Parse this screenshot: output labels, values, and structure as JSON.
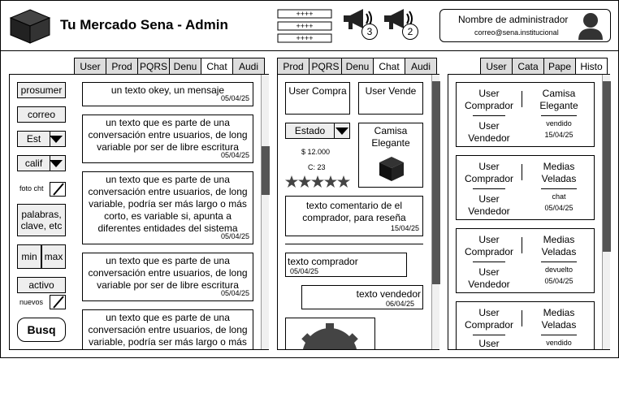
{
  "header": {
    "title": "Tu Mercado Sena - Admin",
    "notifications": [
      {
        "count": "3"
      },
      {
        "count": "2"
      }
    ],
    "admin_name": "Nombre de administrador",
    "admin_email": "correo@sena.institucional"
  },
  "left_panel": {
    "tabs": [
      "User",
      "Prod",
      "PQRS",
      "Denu",
      "Chat",
      "Audi"
    ],
    "active_tab": "Chat",
    "filters": {
      "prosumer": "prosumer",
      "correo": "correo",
      "estado": "Est",
      "calif": "calif",
      "foto_label": "foto cht",
      "keywords": "palabras, clave, etc",
      "min": "min",
      "max": "max",
      "activo": "activo",
      "nuevos_label": "nuevos",
      "search": "Busq"
    },
    "messages": [
      {
        "text": "un texto okey, un mensaje",
        "date": "05/04/25"
      },
      {
        "text": "un texto que es parte de una conversación entre usuarios, de long variable por ser de libre escritura",
        "date": "05/04/25"
      },
      {
        "text": "un texto que es parte de una conversación entre usuarios, de long variable, podría ser más largo o más corto, es variable si, apunta a diferentes entidades del sistema",
        "date": "05/04/25"
      },
      {
        "text": "un texto que es parte de una conversación entre usuarios, de long variable por ser de libre escritura",
        "date": "05/04/25"
      },
      {
        "text": "un texto que es parte de una conversación entre usuarios, de long variable, podría ser más largo o más",
        "date": ""
      }
    ]
  },
  "middle_panel": {
    "tabs": [
      "Prod",
      "PQRS",
      "Denu",
      "Chat",
      "Audi"
    ],
    "active_tab": "Chat",
    "user_buyer": "User Compra",
    "user_seller": "User Vende",
    "estado": "Estado",
    "price": "$ 12.000",
    "count": "C: 23",
    "rating_stars": 5,
    "product_name": "Camisa Elegante",
    "review": {
      "text": "texto comentario de el comprador, para reseña",
      "date": "15/04/25"
    },
    "chat": [
      {
        "text": "texto comprador",
        "date": "05/04/25"
      },
      {
        "text": "texto vendedor",
        "date": "06/04/25"
      }
    ]
  },
  "right_panel": {
    "tabs": [
      "User",
      "Cata",
      "Pape",
      "Histo"
    ],
    "active_tab": "Histo",
    "cards": [
      {
        "buyer": "User Comprador",
        "seller": "User Vendedor",
        "product": "Camisa Elegante",
        "status": "vendido",
        "date": "15/04/25"
      },
      {
        "buyer": "User Comprador",
        "seller": "User Vendedor",
        "product": "Medias Veladas",
        "status": "chat",
        "date": "05/04/25"
      },
      {
        "buyer": "User Comprador",
        "seller": "User Vendedor",
        "product": "Medias Veladas",
        "status": "devuelto",
        "date": "05/04/25"
      },
      {
        "buyer": "User Comprador",
        "seller": "User",
        "product": "Medias Veladas",
        "status": "vendido",
        "date": ""
      }
    ]
  }
}
